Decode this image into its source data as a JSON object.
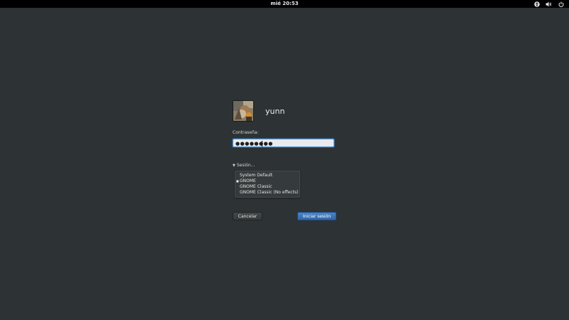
{
  "top_panel": {
    "clock": "mié 20:53",
    "icons": [
      "accessibility-icon",
      "volume-icon",
      "power-icon"
    ]
  },
  "login": {
    "username": "yunn",
    "password_label": "Contraseña:",
    "password_value": "●●●●●●●●",
    "session_toggle": "Sesión...",
    "sessions": [
      "System Default",
      "GNOME",
      "GNOME Classic",
      "GNOME Classic (No effects)"
    ],
    "selected_session": "GNOME",
    "cancel_label": "Cancelar",
    "login_label": "Iniciar sesión"
  },
  "colors": {
    "background": "#2d3234",
    "accent": "#4a90d9",
    "login_button": "#3e77b8"
  }
}
